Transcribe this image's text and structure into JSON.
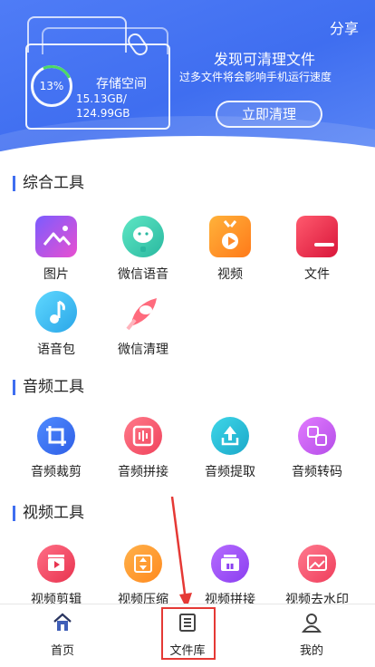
{
  "header": {
    "share": "分享",
    "storage_percent": "13%",
    "storage_label": "存储空间",
    "used": "15.13GB/",
    "total": "124.99GB",
    "title": "发现可清理文件",
    "subtitle": "过多文件将会影响手机运行速度",
    "clean_button": "立即清理",
    "colors": {
      "bg": "#4f7cf6",
      "progress": "#4cd964"
    }
  },
  "sections": {
    "general": {
      "title": "综合工具",
      "items": [
        "图片",
        "微信语音",
        "视频",
        "文件",
        "语音包",
        "微信清理"
      ]
    },
    "audio": {
      "title": "音频工具",
      "items": [
        "音频裁剪",
        "音频拼接",
        "音频提取",
        "音频转码"
      ]
    },
    "video": {
      "title": "视频工具",
      "items": [
        "视频剪辑",
        "视频压缩",
        "视频拼接",
        "视频去水印"
      ]
    }
  },
  "nav": {
    "home": "首页",
    "library": "文件库",
    "profile": "我的"
  }
}
